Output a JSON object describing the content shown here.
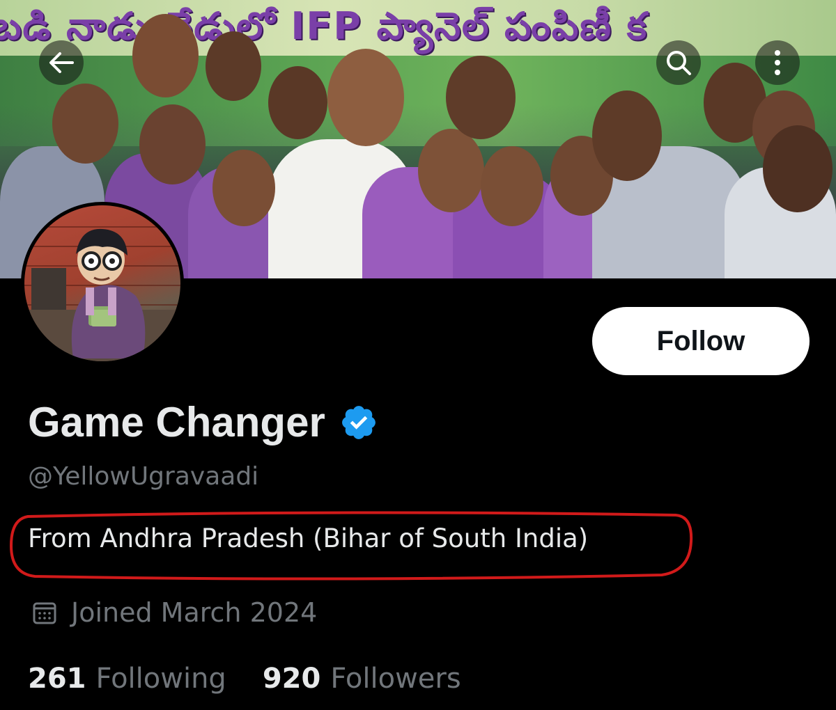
{
  "banner": {
    "text": "బడి నాడు-నేడులో IFP ప్యానెల్ పంపిణీ క"
  },
  "header": {
    "back_icon": "arrow-left-icon",
    "search_icon": "search-icon",
    "more_icon": "more-vertical-icon"
  },
  "profile": {
    "display_name": "Game Changer",
    "verified_icon": "verified-badge-icon",
    "verified_color": "#1d9bf0",
    "handle": "@YellowUgravaadi",
    "bio": "From Andhra Pradesh (Bihar of South India)",
    "joined_icon": "calendar-icon",
    "joined": "Joined March 2024",
    "follow_label": "Follow"
  },
  "stats": {
    "following_count": "261",
    "following_label": "Following",
    "followers_count": "920",
    "followers_label": "Followers"
  },
  "colors": {
    "background": "#000000",
    "primary_text": "#e7e9ea",
    "secondary_text": "#71767b",
    "annotation": "#d11a1a"
  }
}
